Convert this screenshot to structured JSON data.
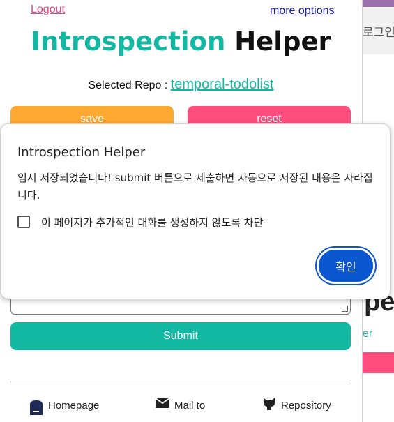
{
  "header": {
    "logout_label": "Logout",
    "more_options_label": "more options",
    "title_part1": "Introspection",
    "title_part2": "Helper",
    "selected_repo_label": "Selected Repo : ",
    "selected_repo_value": "temporal-todolist"
  },
  "actions": {
    "save_label": "save",
    "reset_label": "reset",
    "submit_label": "Submit"
  },
  "footer": {
    "homepage_label": "Homepage",
    "mail_label": "Mail to",
    "repository_label": "Repository"
  },
  "dialog": {
    "title": "Introspection Helper",
    "message": "임시 저장되었습니다! submit 버튼으로 제출하면 자동으로 저장된 내용은 사라집니다.",
    "checkbox_label": "이 페이지가 추가적인 대화를 생성하지 않도록 차단",
    "checkbox_checked": false,
    "ok_label": "확인"
  },
  "background_page": {
    "login_fragment": "로그인",
    "large_fragment": "pe",
    "small_fragment": "er"
  },
  "colors": {
    "accent_teal": "#13b8a2",
    "save_orange": "#ffa832",
    "reset_pink": "#ff4e7e",
    "dialog_button_blue": "#0b57d0"
  }
}
